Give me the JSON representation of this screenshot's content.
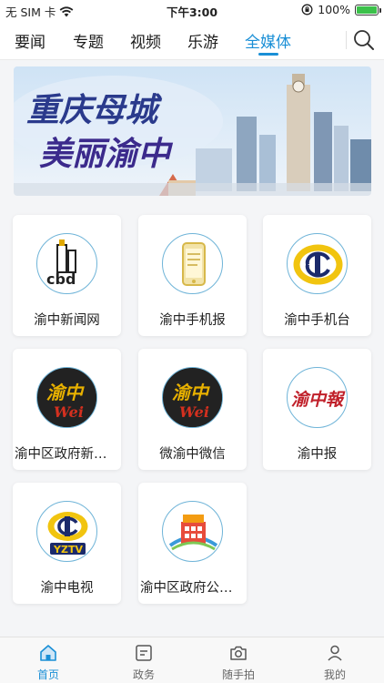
{
  "status_bar": {
    "carrier": "无 SIM 卡",
    "time": "下午3:00",
    "battery_percent": "100%",
    "battery_level": 1.0
  },
  "tabs": [
    {
      "label": "要闻",
      "active": false
    },
    {
      "label": "专题",
      "active": false
    },
    {
      "label": "视频",
      "active": false
    },
    {
      "label": "乐游",
      "active": false
    },
    {
      "label": "全媒体",
      "active": true
    }
  ],
  "banner": {
    "line1": "重庆母城",
    "line2": "美丽渝中"
  },
  "media_items": [
    {
      "label": "渝中新闻网",
      "icon": "cbd-logo-icon"
    },
    {
      "label": "渝中手机报",
      "icon": "phone-newspaper-icon"
    },
    {
      "label": "渝中手机台",
      "icon": "yz-tv-emblem-icon"
    },
    {
      "label": "渝中区政府新闻…",
      "icon": "yuzhong-wei-icon"
    },
    {
      "label": "微渝中微信",
      "icon": "yuzhong-wei-icon"
    },
    {
      "label": "渝中报",
      "icon": "yuzhong-bao-icon"
    },
    {
      "label": "渝中电视",
      "icon": "yztv-icon"
    },
    {
      "label": "渝中区政府公众…",
      "icon": "government-building-icon"
    }
  ],
  "logo_text": {
    "cbd": "cbd",
    "yuzhong": "渝中",
    "wei": "Wei",
    "bao": "渝中報",
    "yztv": "YZTV"
  },
  "bottom_nav": [
    {
      "label": "首页",
      "active": true,
      "icon": "home-icon"
    },
    {
      "label": "政务",
      "active": false,
      "icon": "document-icon"
    },
    {
      "label": "随手拍",
      "active": false,
      "icon": "camera-icon"
    },
    {
      "label": "我的",
      "active": false,
      "icon": "user-icon"
    }
  ],
  "colors": {
    "accent": "#1a8fd6",
    "banner_text": "#2a3a8c"
  }
}
